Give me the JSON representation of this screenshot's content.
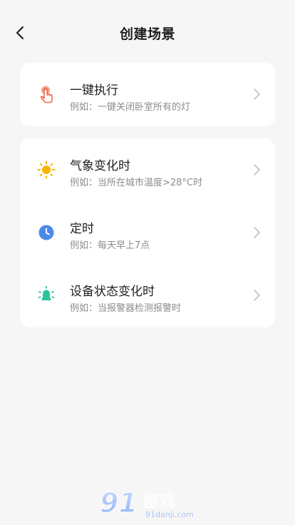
{
  "header": {
    "title": "创建场景",
    "back_icon": "chevron-left-icon"
  },
  "cards": [
    {
      "items": [
        {
          "title": "一键执行",
          "desc": "例如：一键关闭卧室所有的灯",
          "icon": "tap-hand-icon",
          "icon_color": "#f26a4b"
        }
      ]
    },
    {
      "items": [
        {
          "title": "气象变化时",
          "desc": "例如：当所在城市温度>28°C时",
          "icon": "sun-icon",
          "icon_color": "#f8b300"
        },
        {
          "title": "定时",
          "desc": "例如：每天早上7点",
          "icon": "clock-icon",
          "icon_color": "#4a8ae8"
        },
        {
          "title": "设备状态变化时",
          "desc": "例如：当报警器检测报警时",
          "icon": "device-alarm-icon",
          "icon_color": "#28c49a"
        }
      ]
    }
  ],
  "watermark": {
    "brand_logo": "91游戏",
    "site": "91danji.com"
  }
}
